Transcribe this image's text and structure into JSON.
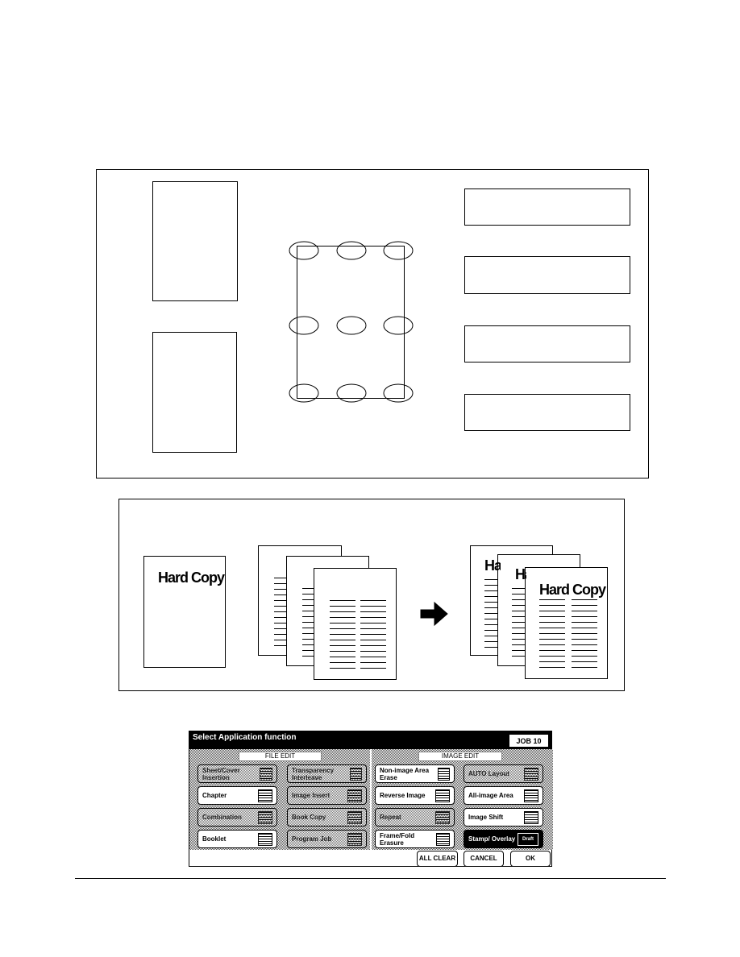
{
  "figure2": {
    "hard_copy_label": "Hard Copy"
  },
  "panel": {
    "title": "Select Application function",
    "job": "JOB 10",
    "file_edit": {
      "label": "FILE EDIT",
      "buttons": [
        {
          "label": "Sheet/Cover Insertion",
          "state": "disabled"
        },
        {
          "label": "Transparency Interleave",
          "state": "disabled"
        },
        {
          "label": "Chapter",
          "state": "enabled"
        },
        {
          "label": "Image Insert",
          "state": "disabled"
        },
        {
          "label": "Combination",
          "state": "disabled"
        },
        {
          "label": "Book Copy",
          "state": "disabled"
        },
        {
          "label": "Booklet",
          "state": "enabled"
        },
        {
          "label": "Program Job",
          "state": "disabled"
        }
      ]
    },
    "image_edit": {
      "label": "IMAGE EDIT",
      "buttons": [
        {
          "label": "Non-image Area Erase",
          "state": "enabled"
        },
        {
          "label": "AUTO Layout",
          "state": "disabled"
        },
        {
          "label": "Reverse Image",
          "state": "enabled"
        },
        {
          "label": "All-image Area",
          "state": "enabled"
        },
        {
          "label": "Repeat",
          "state": "disabled"
        },
        {
          "label": "Image Shift",
          "state": "enabled"
        },
        {
          "label": "Frame/Fold Erasure",
          "state": "enabled"
        },
        {
          "label": "Stamp/ Overlay",
          "state": "selected",
          "icon_text": "Draft"
        }
      ]
    },
    "all_clear": "ALL CLEAR",
    "cancel": "CANCEL",
    "ok": "OK"
  }
}
